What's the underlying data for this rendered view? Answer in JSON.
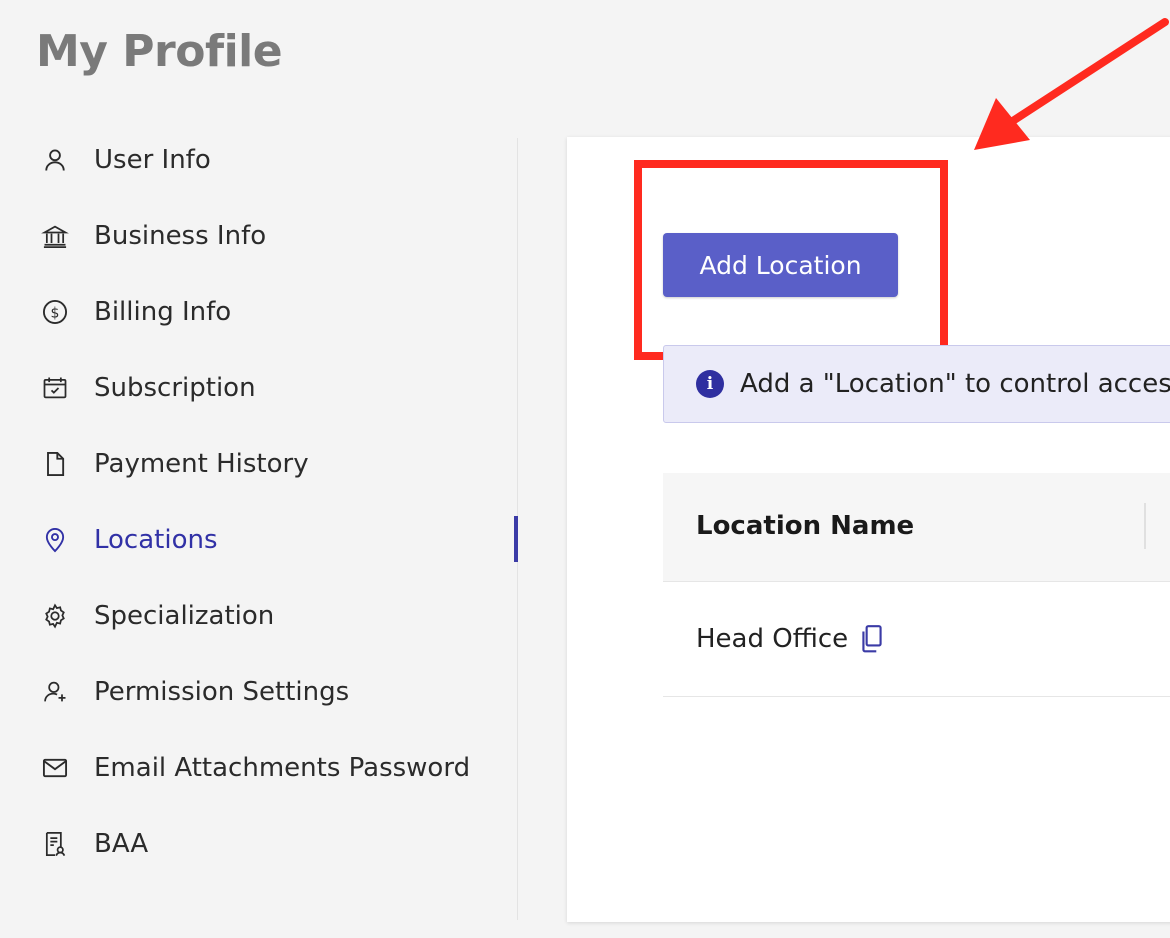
{
  "page": {
    "title": "My Profile"
  },
  "sidebar": {
    "items": [
      {
        "label": "User Info",
        "icon": "user-icon"
      },
      {
        "label": "Business Info",
        "icon": "bank-icon"
      },
      {
        "label": "Billing Info",
        "icon": "dollar-circle-icon"
      },
      {
        "label": "Subscription",
        "icon": "calendar-check-icon"
      },
      {
        "label": "Payment History",
        "icon": "document-icon"
      },
      {
        "label": "Locations",
        "icon": "location-pin-icon",
        "active": true
      },
      {
        "label": "Specialization",
        "icon": "gear-icon"
      },
      {
        "label": "Permission Settings",
        "icon": "user-plus-icon"
      },
      {
        "label": "Email Attachments Password",
        "icon": "envelope-icon"
      },
      {
        "label": "BAA",
        "icon": "certificate-icon"
      }
    ]
  },
  "main": {
    "add_button_label": "Add Location",
    "info_banner": "Add a \"Location\" to control access",
    "table": {
      "columns": [
        "Location Name"
      ],
      "rows": [
        {
          "name": "Head Office"
        }
      ]
    }
  },
  "colors": {
    "accent": "#5a5fc8",
    "active_text": "#3131a6",
    "annotation": "#ff2a1f",
    "banner_bg": "#ebebf9"
  }
}
